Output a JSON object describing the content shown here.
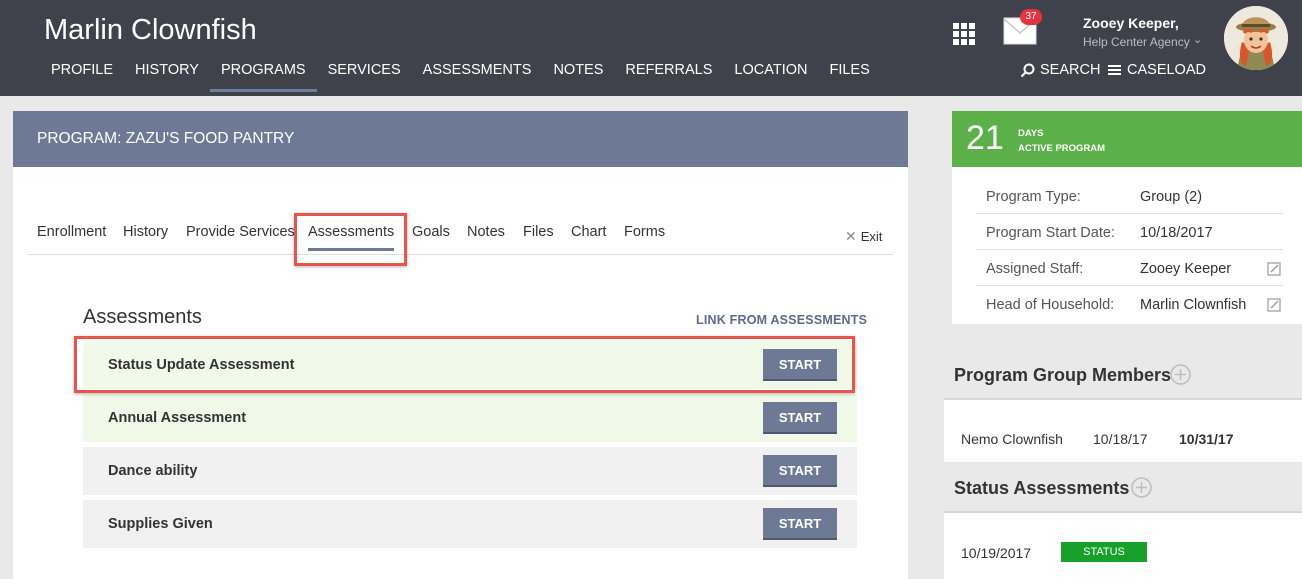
{
  "header": {
    "client_name": "Marlin Clownfish",
    "nav": [
      {
        "label": "PROFILE"
      },
      {
        "label": "HISTORY"
      },
      {
        "label": "PROGRAMS"
      },
      {
        "label": "SERVICES"
      },
      {
        "label": "ASSESSMENTS"
      },
      {
        "label": "NOTES"
      },
      {
        "label": "REFERRALS"
      },
      {
        "label": "LOCATION"
      },
      {
        "label": "FILES"
      }
    ],
    "active_nav": "PROGRAMS",
    "notification_count": "37",
    "user_name": "Zooey Keeper,",
    "agency": "Help Center Agency",
    "search_label": "SEARCH",
    "caseload_label": "CASELOAD",
    "icons": {
      "apps": "grid-icon",
      "mail": "mail-icon",
      "search": "search-icon",
      "caseload": "menu-icon",
      "agency": "chevron-down-icon"
    }
  },
  "program": {
    "title": "PROGRAM: ZAZU'S FOOD PANTRY",
    "tabs": [
      {
        "label": "Enrollment"
      },
      {
        "label": "History"
      },
      {
        "label": "Provide Services"
      },
      {
        "label": "Assessments"
      },
      {
        "label": "Goals"
      },
      {
        "label": "Notes"
      },
      {
        "label": "Files"
      },
      {
        "label": "Chart"
      },
      {
        "label": "Forms"
      }
    ],
    "active_tab": "Assessments",
    "exit_label": "Exit"
  },
  "assessments": {
    "title": "Assessments",
    "link_from_label": "LINK FROM ASSESSMENTS",
    "start_label": "START",
    "items": [
      {
        "name": "Status Update Assessment"
      },
      {
        "name": "Annual Assessment"
      },
      {
        "name": "Dance ability"
      },
      {
        "name": "Supplies Given"
      }
    ]
  },
  "program_info": {
    "days": "21",
    "days_label_1": "DAYS",
    "days_label_2": "ACTIVE PROGRAM",
    "rows": [
      {
        "label": "Program Type:",
        "value": "Group (2)"
      },
      {
        "label": "Program Start Date:",
        "value": "10/18/2017"
      },
      {
        "label": "Assigned Staff:",
        "value": "Zooey Keeper"
      },
      {
        "label": "Head of Household:",
        "value": "Marlin Clownfish"
      }
    ]
  },
  "group_members": {
    "title": "Program Group Members",
    "members": [
      {
        "name": "Nemo Clownfish",
        "start": "10/18/17",
        "end": "10/31/17"
      }
    ]
  },
  "status_assessments": {
    "title": "Status Assessments",
    "items": [
      {
        "date": "10/19/2017",
        "badge": "STATUS"
      }
    ]
  },
  "colors": {
    "header_bg": "#3f424b",
    "program_bar": "#6e7a95",
    "days_green": "#5bb04a",
    "status_green": "#17a02a",
    "highlight_red": "#e8554b",
    "row_green": "#f1f9e8",
    "row_gray": "#f1f1f1"
  }
}
